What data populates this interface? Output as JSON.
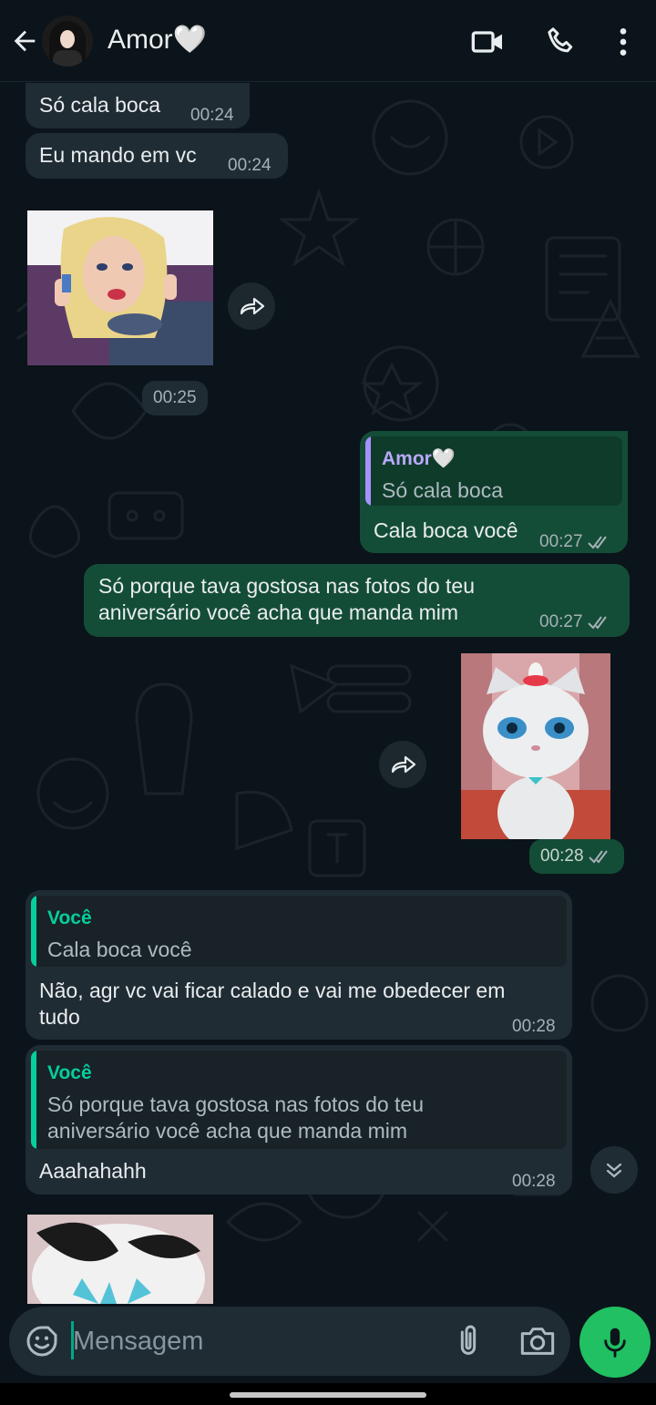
{
  "header": {
    "contact_name": "Amor🤍",
    "icons": [
      "back-arrow-icon",
      "video-call-icon",
      "voice-call-icon",
      "more-options-icon"
    ]
  },
  "messages": [
    {
      "dir": "in",
      "text": "Só cala boca",
      "time": "00:24"
    },
    {
      "dir": "in",
      "text": "Eu mando em vc",
      "time": "00:24"
    },
    {
      "dir": "in",
      "type": "sticker",
      "desc": "cartoon-doll-on-phone",
      "time": "00:25"
    },
    {
      "dir": "out",
      "quote": {
        "author": "Amor🤍",
        "text": "Só cala boca"
      },
      "text": "Cala boca você",
      "time": "00:27",
      "status": "read"
    },
    {
      "dir": "out",
      "text": "Só porque tava gostosa nas fotos do teu aniversário você acha que manda mim",
      "time": "00:27",
      "status": "read"
    },
    {
      "dir": "out",
      "type": "sticker",
      "desc": "white-cat-character",
      "time": "00:28",
      "status": "read"
    },
    {
      "dir": "in",
      "quote": {
        "author": "Você",
        "text": "Cala boca você"
      },
      "text": "Não, agr vc vai ficar calado e vai me obedecer em tudo",
      "time": "00:28"
    },
    {
      "dir": "in",
      "quote": {
        "author": "Você",
        "text": "Só porque tava gostosa nas fotos do teu aniversário você acha que manda mim"
      },
      "text": "Aaahahahh",
      "time": "00:28"
    },
    {
      "dir": "in",
      "type": "sticker",
      "desc": "black-white-cat-partial"
    }
  ],
  "composer": {
    "placeholder": "Mensagem"
  },
  "colors": {
    "background": "#0b141a",
    "incoming_bubble": "#202c33",
    "outgoing_bubble": "#144d37",
    "accent_green": "#21c063",
    "quote_green": "#06cf9c",
    "quote_purple": "#a791ff",
    "read_ticks": "#a6b1b7"
  }
}
